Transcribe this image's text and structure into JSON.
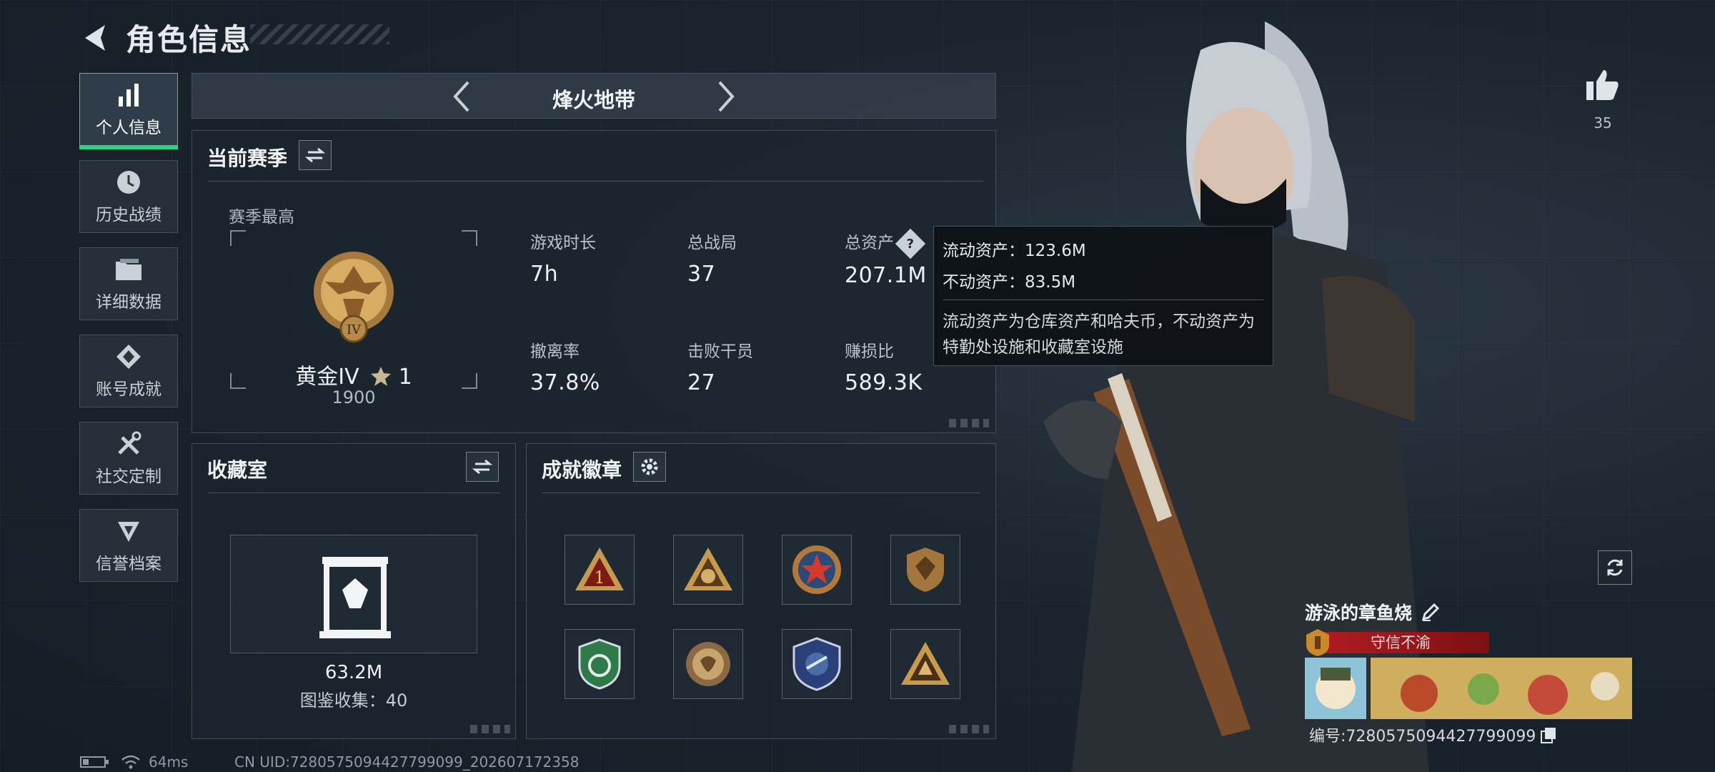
{
  "header": {
    "title": "角色信息"
  },
  "sidebar": {
    "items": [
      {
        "label": "个人信息",
        "icon": "bar-chart-icon",
        "active": true
      },
      {
        "label": "历史战绩",
        "icon": "clock-icon"
      },
      {
        "label": "详细数据",
        "icon": "folder-icon"
      },
      {
        "label": "账号成就",
        "icon": "medal-icon"
      },
      {
        "label": "社交定制",
        "icon": "wrench-icon"
      },
      {
        "label": "信誉档案",
        "icon": "shield-icon"
      }
    ]
  },
  "mode": {
    "title": "烽火地带"
  },
  "season": {
    "title": "当前赛季",
    "best_label": "赛季最高",
    "rank_name": "黄金IV",
    "rank_stars": "1",
    "rank_score": "1900",
    "rank_tier_numeral": "IV",
    "stats": [
      {
        "label": "游戏时长",
        "value": "7h"
      },
      {
        "label": "总战局",
        "value": "37"
      },
      {
        "label": "总资产",
        "value": "207.1M"
      },
      {
        "label": "撤离率",
        "value": "37.8%"
      },
      {
        "label": "击败干员",
        "value": "27"
      },
      {
        "label": "赚损比",
        "value": "589.3K"
      }
    ]
  },
  "tooltip": {
    "liquid": "流动资产：123.6M",
    "fixed": "不动资产：83.5M",
    "note": "流动资产为仓库资产和哈夫币，不动资产为特勤处设施和收藏室设施"
  },
  "vault": {
    "title": "收藏室",
    "value": "63.2M",
    "count": "图鉴收集：40"
  },
  "badges": {
    "title": "成就徽章"
  },
  "like": {
    "count": "35"
  },
  "player": {
    "name": "游泳的章鱼烧",
    "title": "守信不渝",
    "id": "编号:7280575094427799099"
  },
  "status": {
    "ping": "64ms",
    "uid": "CN UID:7280575094427799099_202607172358"
  },
  "colors": {
    "accent_green": "#2fd186",
    "title_red": "#b31d22",
    "gold": "#c89a4e"
  }
}
